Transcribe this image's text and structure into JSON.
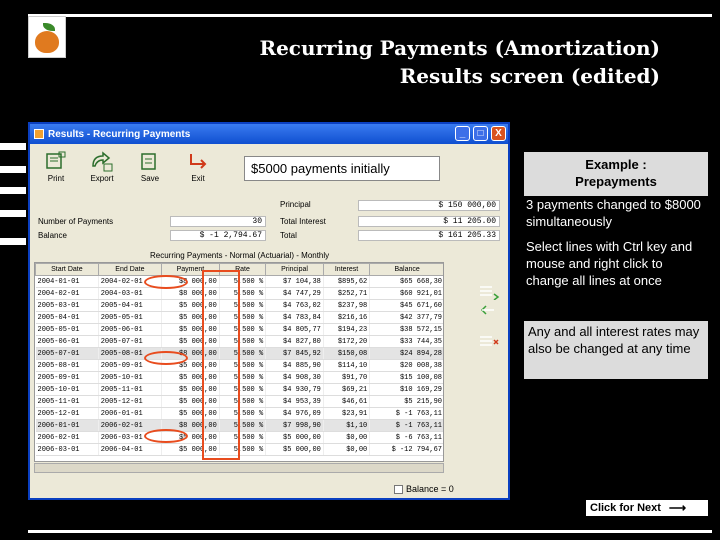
{
  "slide": {
    "title_line1": "Recurring Payments (Amortization)",
    "title_line2": "Results screen (edited)"
  },
  "window": {
    "title": "Results - Recurring Payments",
    "controls": [
      "_",
      "□",
      "X"
    ]
  },
  "toolbar": {
    "print": "Print",
    "export": "Export",
    "save": "Save",
    "exit": "Exit"
  },
  "callout": "$5000 payments initially",
  "summary": {
    "num_payments_label": "Number of Payments",
    "num_payments_value": "30",
    "balance_label": "Balance",
    "balance_value": "$ -1 2,794.67",
    "principal_label": "Principal",
    "principal_value": "$ 150 000,00",
    "total_interest_label": "Total Interest",
    "total_interest_value": "$ 11 205.00",
    "total_label": "Total",
    "total_value": "$ 161 205.33"
  },
  "table": {
    "title": "Recurring Payments - Normal (Actuarial) - Monthly",
    "headers": [
      "Start Date",
      "End Date",
      "Payment",
      "Rate",
      "Principal",
      "Interest",
      "Balance"
    ],
    "rows": [
      [
        "2004-01-01",
        "2004-02-01",
        "$8 000,00",
        "5,500 %",
        "$7 104,38",
        "$895,62",
        "$65 668,30"
      ],
      [
        "2004-02-01",
        "2004-03-01",
        "$8 000,00",
        "5,500 %",
        "$4 747,29",
        "$252,71",
        "$60 921,01"
      ],
      [
        "2005-03-01",
        "2005-04-01",
        "$5 000,00",
        "5,500 %",
        "$4 763,02",
        "$237,98",
        "$45 671,60"
      ],
      [
        "2005-04-01",
        "2005-05-01",
        "$5 000,00",
        "5,500 %",
        "$4 783,84",
        "$216,16",
        "$42 377,79"
      ],
      [
        "2005-05-01",
        "2005-06-01",
        "$5 000,00",
        "5,500 %",
        "$4 805,77",
        "$194,23",
        "$38 572,15"
      ],
      [
        "2005-06-01",
        "2005-07-01",
        "$5 000,00",
        "5,500 %",
        "$4 827,80",
        "$172,20",
        "$33 744,35"
      ],
      [
        "2005-07-01",
        "2005-08-01",
        "$8 000,00",
        "5,500 %",
        "$7 845,92",
        "$150,08",
        "$24 894,28"
      ],
      [
        "2005-08-01",
        "2005-09-01",
        "$5 000,00",
        "5,500 %",
        "$4 885,90",
        "$114,10",
        "$20 008,38"
      ],
      [
        "2005-09-01",
        "2005-10-01",
        "$5 000,00",
        "5,500 %",
        "$4 908,30",
        "$91,70",
        "$15 100,08"
      ],
      [
        "2005-10-01",
        "2005-11-01",
        "$5 000,00",
        "5,500 %",
        "$4 930,79",
        "$69,21",
        "$10 169,29"
      ],
      [
        "2005-11-01",
        "2005-12-01",
        "$5 000,00",
        "5,500 %",
        "$4 953,39",
        "$46,61",
        "$5 215,90"
      ],
      [
        "2005-12-01",
        "2006-01-01",
        "$5 000,00",
        "5,500 %",
        "$4 976,09",
        "$23,91",
        "$ -1 763,11"
      ],
      [
        "2006-01-01",
        "2006-02-01",
        "$8 000,00",
        "5,500 %",
        "$7 998,90",
        "$1,10",
        "$ -1 763,11"
      ],
      [
        "2006-02-01",
        "2006-03-01",
        "$5 000,00",
        "5,500 %",
        "$5 000,00",
        "$0,00",
        "$ -6 763,11"
      ],
      [
        "2006-03-01",
        "2006-04-01",
        "$5 000,00",
        "5,500 %",
        "$5 000,00",
        "$0,00",
        "$ -12 794,67"
      ]
    ],
    "selected_rows": [
      6,
      12
    ]
  },
  "balance_checkbox": "Balance = 0",
  "example_box": {
    "line1": "Example :",
    "line2": "Prepayments"
  },
  "notes": {
    "note1": "3 payments changed to $8000 simultaneously",
    "note2": "Select lines with Ctrl key and mouse and right click to change all lines at once",
    "note3": "Any and all interest rates may also be changed at any time"
  },
  "next_button": "Click for Next",
  "colors": {
    "highlight": "#e84c1e",
    "window_frame": "#0a3fc0",
    "window_bg": "#ece9d8",
    "slide_bg": "#000000"
  }
}
